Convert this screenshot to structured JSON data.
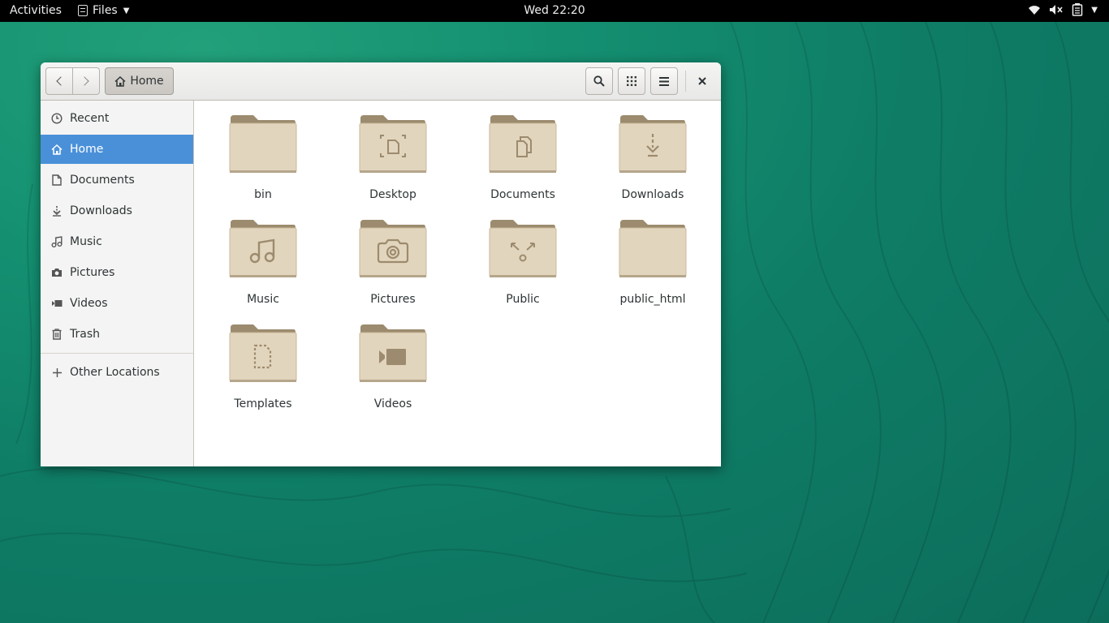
{
  "topbar": {
    "activities": "Activities",
    "app_name": "Files",
    "clock": "Wed 22:20",
    "status_icons": [
      "wifi-icon",
      "volume-muted-icon",
      "battery-icon",
      "system-menu-caret"
    ]
  },
  "window": {
    "path_button": "Home",
    "header_buttons": [
      "back-icon",
      "forward-icon",
      "search-icon",
      "grid-view-icon",
      "hamburger-menu-icon",
      "close-icon"
    ]
  },
  "sidebar": {
    "items": [
      {
        "label": "Recent",
        "icon": "clock-icon"
      },
      {
        "label": "Home",
        "icon": "home-icon",
        "active": true
      },
      {
        "label": "Documents",
        "icon": "document-icon"
      },
      {
        "label": "Downloads",
        "icon": "download-icon"
      },
      {
        "label": "Music",
        "icon": "music-icon"
      },
      {
        "label": "Pictures",
        "icon": "camera-icon"
      },
      {
        "label": "Videos",
        "icon": "video-icon"
      },
      {
        "label": "Trash",
        "icon": "trash-icon"
      }
    ],
    "other_locations": "Other Locations"
  },
  "files": [
    {
      "name": "bin",
      "emblem": "none"
    },
    {
      "name": "Desktop",
      "emblem": "desktop"
    },
    {
      "name": "Documents",
      "emblem": "documents"
    },
    {
      "name": "Downloads",
      "emblem": "download"
    },
    {
      "name": "Music",
      "emblem": "music"
    },
    {
      "name": "Pictures",
      "emblem": "camera"
    },
    {
      "name": "Public",
      "emblem": "share"
    },
    {
      "name": "public_html",
      "emblem": "none"
    },
    {
      "name": "Templates",
      "emblem": "template"
    },
    {
      "name": "Videos",
      "emblem": "video"
    }
  ],
  "colors": {
    "accent": "#4a90d9",
    "folder_body": "#e2d5bd",
    "folder_tab": "#9c8b6e",
    "topbar": "#000000"
  }
}
